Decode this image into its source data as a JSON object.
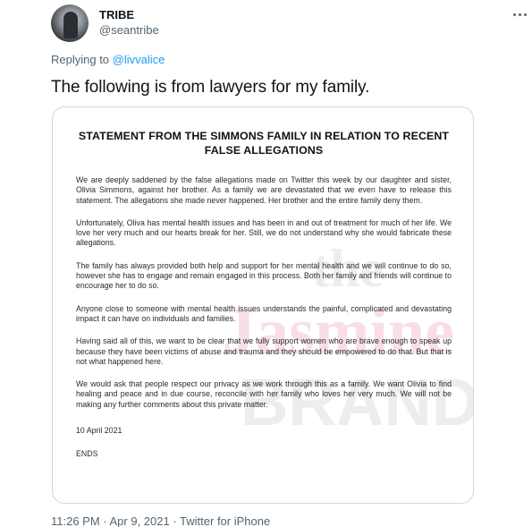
{
  "author": {
    "display_name": "TRIBE",
    "handle": "@seantribe"
  },
  "reply": {
    "prefix": "Replying to ",
    "mention": "@livvalice"
  },
  "tweet_text": "The following is from lawyers for my family.",
  "statement": {
    "title": "STATEMENT FROM THE SIMMONS FAMILY IN RELATION TO RECENT FALSE ALLEGATIONS",
    "paragraphs": [
      "We are deeply saddened by the false allegations made on Twitter this week by our daughter and sister, Olivia Simmons, against her brother. As a family we are devastated that we even have to release this statement. The allegations she made never happened. Her brother and the entire family deny them.",
      "Unfortunately, Oliva has mental health issues and has been in and out of treatment for much of her life. We love her very much and our hearts break for her. Still, we do not understand why she would fabricate these allegations.",
      "The family has always provided both help and support for her mental health and we will continue to do so, however she has to engage and remain engaged in this process. Both her family and friends will continue to encourage her to do so.",
      "Anyone close to someone with mental health issues understands the painful, complicated and devastating impact it can have on individuals and families.",
      "Having said all of this, we want to be clear that we fully support women who are brave enough to speak up because they have been victims of abuse and trauma and they should be empowered to do that. But that is not what happened here.",
      "We would ask that people respect our privacy as we work through this as a family. We want Olivia to find healing and peace and in due course, reconcile with her family who loves her very much. We will not be making any further comments about this private matter."
    ],
    "date": "10 April 2021",
    "ends": "ENDS"
  },
  "watermark": {
    "line1": "the",
    "line2": "Jasmine",
    "line3": "BRAND"
  },
  "footer": {
    "meta": "11:26 PM · Apr 9, 2021 · Twitter for iPhone"
  },
  "icons": {
    "more": "more-horizontal-icon",
    "avatar": "avatar"
  },
  "colors": {
    "link": "#1d9bf0",
    "secondary_text": "#536471",
    "primary_text": "#0f1419",
    "border": "#cfd9de",
    "watermark_pink": "#f3b7c6"
  }
}
